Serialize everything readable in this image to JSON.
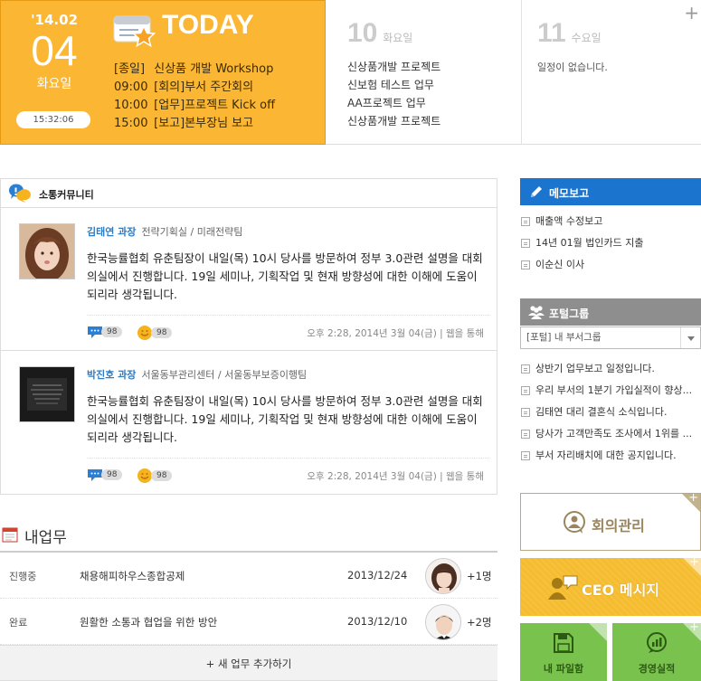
{
  "today": {
    "year_month": "'14.02",
    "day": "04",
    "weekday": "화요일",
    "clock": "15:32:06",
    "title": "TODAY",
    "events": [
      {
        "time": "[종일]",
        "text": "신상품 개발 Workshop"
      },
      {
        "time": "09:00",
        "text": "[회의]부서 주간회의"
      },
      {
        "time": "10:00",
        "text": "[업무]프로젝트 Kick off"
      },
      {
        "time": "15:00",
        "text": "[보고]본부장님 보고"
      }
    ]
  },
  "day10": {
    "num": "10",
    "weekday": "화요일",
    "events": [
      "신상품개발 프로젝트",
      "신보험 테스트 업무",
      "AA프로젝트 업무",
      "신상품개발 프로젝트"
    ]
  },
  "day11": {
    "num": "11",
    "weekday": "수요일",
    "empty": "일정이 없습니다.",
    "add": "+"
  },
  "community": {
    "title": "소통커뮤니티",
    "posts": [
      {
        "name": "김태연 과장",
        "dept": "전략기획실 / 미래전략팀",
        "body": "한국능률협회 유춘팀장이 내일(목) 10시 당사를 방문하여 정부 3.0관련 설명을 대회의실에서 진행합니다. 19일 세미나, 기획작업 및 현재 방향성에 대한 이해에 도움이 되리라 생각됩니다.",
        "comments": "98",
        "likes": "98",
        "meta": "오후 2:28, 2014년 3월 04(금)   |   웹을 통해"
      },
      {
        "name": "박진호 과장",
        "dept": "서울동부관리센터 / 서울동부보증이행팀",
        "body": "한국능률협회 유춘팀장이 내일(목) 10시 당사를 방문하여 정부 3.0관련 설명을 대회의실에서 진행합니다. 19일 세미나, 기획작업 및 현재 방향성에 대한 이해에 도움이 되리라 생각됩니다.",
        "comments": "98",
        "likes": "98",
        "meta": "오후 2:28, 2014년 3월 04(금)   |   웹을 통해"
      }
    ]
  },
  "tasks": {
    "title": "내업무",
    "rows": [
      {
        "status": "진행중",
        "name": "채용해피하우스종합공제",
        "date": "2013/12/24",
        "extra": "+1명"
      },
      {
        "status": "완료",
        "name": "원활한 소통과 협업을 위한 방안",
        "date": "2013/12/10",
        "extra": "+2명"
      }
    ],
    "add_label": "+ 새 업무 추가하기"
  },
  "memo": {
    "title": "메모보고",
    "items": [
      "매출액 수정보고",
      "14년 01월 법인카드 지출",
      "이순신 이사"
    ]
  },
  "portal": {
    "title": "포털그룹",
    "select": "[포털] 내 부서그룹",
    "items": [
      "상반기 업무보고 일정입니다.",
      "우리 부서의 1분기 가입실적이 향상...",
      "김태연 대리 결혼식 소식입니다.",
      "당사가 고객만족도 조사에서 1위를 ...",
      "부서 자리배치에 대한 공지입니다."
    ]
  },
  "tiles": {
    "meeting": "회의관리",
    "ceo": "CEO 메시지",
    "file": "내 파일함",
    "mgmt": "경영실적",
    "plus": "+"
  },
  "colors": {
    "today_bg": "#fbb633",
    "memo_bg": "#1b74cd",
    "portal_bg": "#8e8e8e",
    "ceo_bg": "#f4bc2e",
    "green_tile": "#79c24e",
    "author_name": "#2e7cc3"
  }
}
